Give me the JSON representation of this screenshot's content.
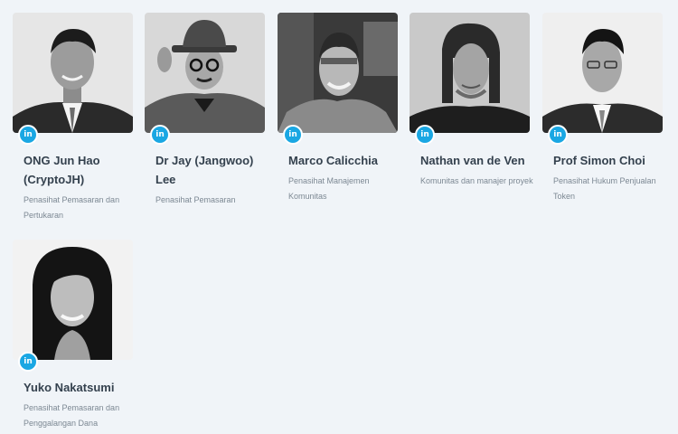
{
  "team": [
    {
      "name": "ONG Jun Hao (CryptoJH)",
      "role": "Penasihat Pemasaran dan Pertukaran",
      "social": "in"
    },
    {
      "name": "Dr Jay (Jangwoo) Lee",
      "role": "Penasihat Pemasaran",
      "social": "in"
    },
    {
      "name": "Marco Calicchia",
      "role": "Penasihat Manajemen Komunitas",
      "social": "in"
    },
    {
      "name": "Nathan van de Ven",
      "role": "Komunitas dan manajer proyek",
      "social": "in"
    },
    {
      "name": "Prof Simon Choi",
      "role": "Penasihat Hukum Penjualan Token",
      "social": "in"
    },
    {
      "name": "Yuko Nakatsumi",
      "role": "Penasihat Pemasaran dan Penggalangan Dana",
      "social": "in"
    }
  ],
  "colors": {
    "background": "#f0f4f8",
    "linkedin": "#1aa7e3",
    "name": "#34414e",
    "role": "#7c8893"
  },
  "icons": {
    "social": "linkedin-icon"
  }
}
